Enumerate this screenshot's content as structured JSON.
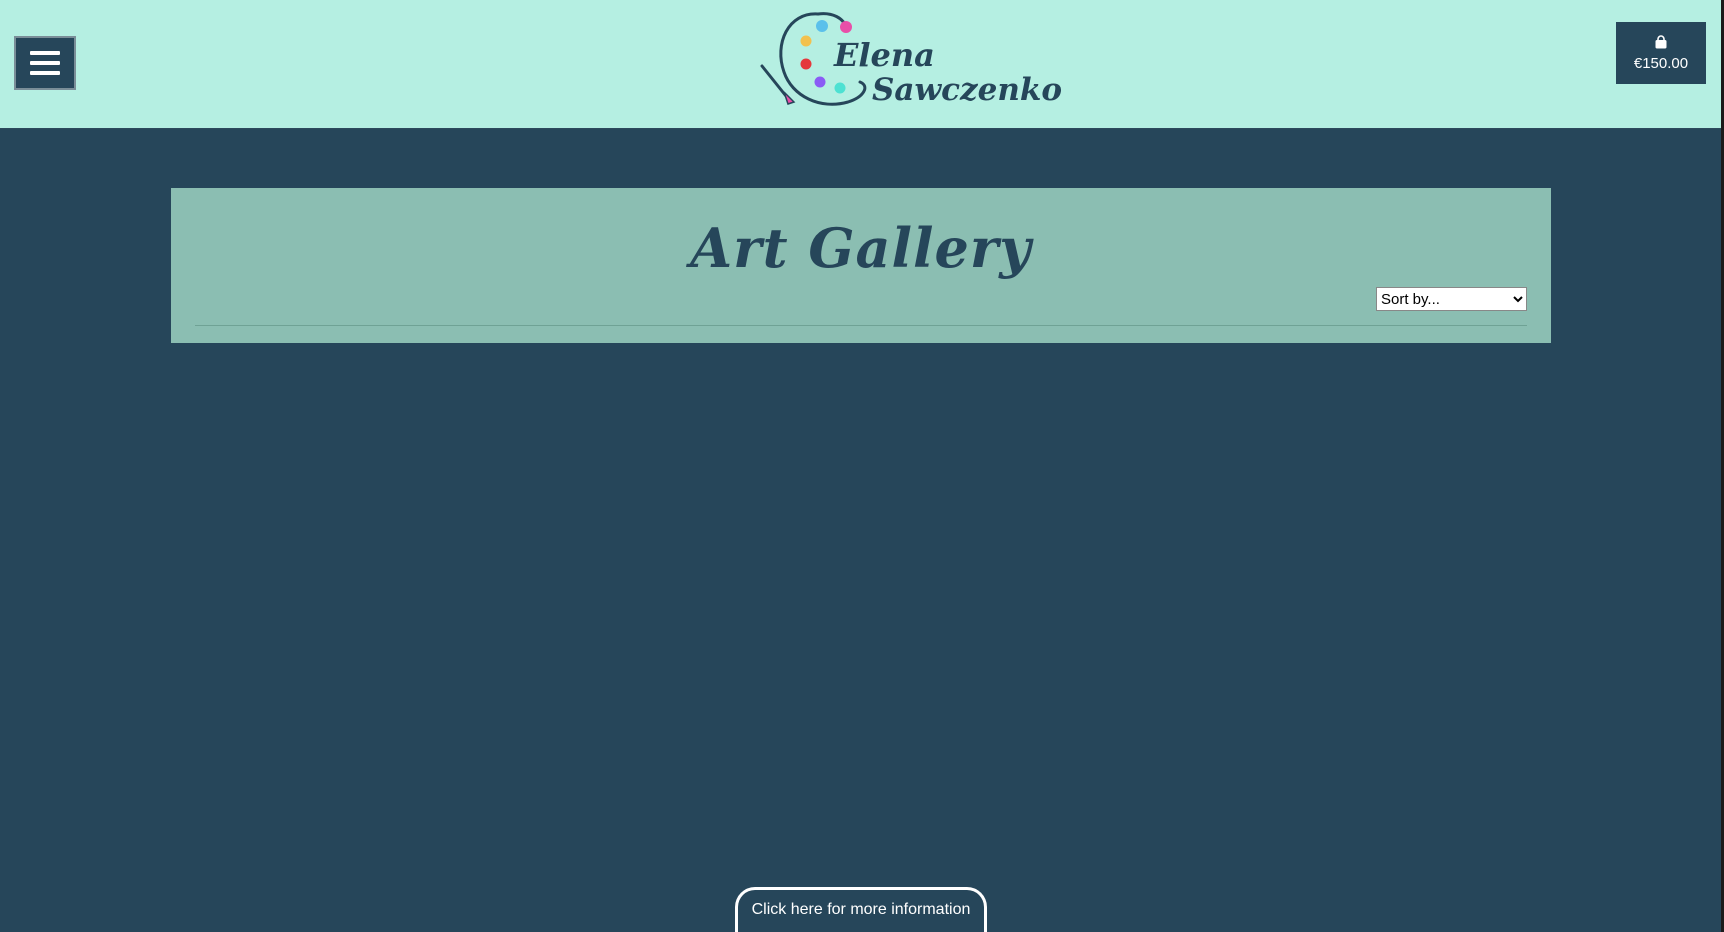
{
  "header": {
    "logo": {
      "line1": "Elena",
      "line2": "Sawczenko",
      "palette_colors": [
        "#5bc0eb",
        "#e84fa8",
        "#f2c14e",
        "#e5383b",
        "#8a5cf5",
        "#4de1d2"
      ]
    },
    "menu_icon": "hamburger-icon",
    "cart": {
      "icon": "shopping-bag-icon",
      "total": "€150.00"
    }
  },
  "gallery": {
    "title": "Art Gallery",
    "sort": {
      "selected": "Sort by..."
    }
  },
  "footer": {
    "info_button_label": "Click here for more information"
  },
  "colors": {
    "header_bg": "#b5efe2",
    "page_bg": "#26465a",
    "panel_bg": "#8bbeb2"
  }
}
